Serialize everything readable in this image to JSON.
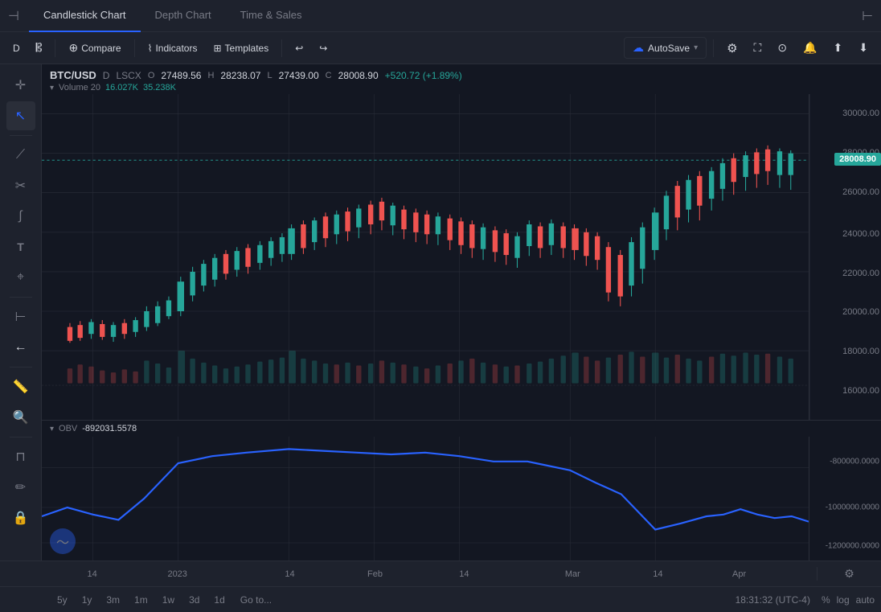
{
  "tabs": {
    "candlestick": "Candlestick Chart",
    "depth": "Depth Chart",
    "timesales": "Time & Sales"
  },
  "toolbar": {
    "timeframe": "D",
    "compare": "Compare",
    "indicators": "Indicators",
    "templates": "Templates",
    "autosave": "AutoSave",
    "undo_icon": "↩",
    "redo_icon": "↪"
  },
  "symbol": {
    "pair": "BTC/USD",
    "timeframe": "D",
    "exchange": "LSCX",
    "open_label": "O",
    "open": "27489.56",
    "high_label": "H",
    "high": "28238.07",
    "low_label": "L",
    "low": "27439.00",
    "close_label": "C",
    "close": "28008.90",
    "change": "+520.72 (+1.89%)"
  },
  "volume": {
    "label": "Volume 20",
    "val1": "16.027K",
    "val2": "35.238K"
  },
  "obv": {
    "label": "OBV",
    "value": "-892031.5578"
  },
  "price_levels": {
    "30000": "30000.00",
    "28008": "28008.90",
    "26000": "26000.00",
    "24000": "24000.00",
    "22000": "22000.00",
    "20000": "20000.00",
    "18000": "18000.00",
    "16000": "16000.00"
  },
  "obv_levels": {
    "neg800k": "-800000.0000",
    "neg1000k": "-1000000.0000",
    "neg1200k": "-1200000.0000"
  },
  "time_labels": [
    "14",
    "2023",
    "14",
    "Feb",
    "14",
    "Mar",
    "14",
    "Apr"
  ],
  "time_positions": [
    40,
    120,
    230,
    330,
    430,
    560,
    660,
    800
  ],
  "bottom_bar": {
    "periods": [
      "5y",
      "1y",
      "3m",
      "1m",
      "1w",
      "3d",
      "1d"
    ],
    "goto": "Go to...",
    "time": "18:31:32 (UTC-4)",
    "pct": "%",
    "log": "log",
    "auto": "auto"
  },
  "colors": {
    "bull": "#26a69a",
    "bear": "#ef5350",
    "bull_volume": "#26a69a44",
    "bear_volume": "#ef535044",
    "obv_line": "#2962ff",
    "bg": "#131722",
    "panel_bg": "#1e222d",
    "border": "#2a2e39",
    "current_price_bg": "#26a69a"
  }
}
